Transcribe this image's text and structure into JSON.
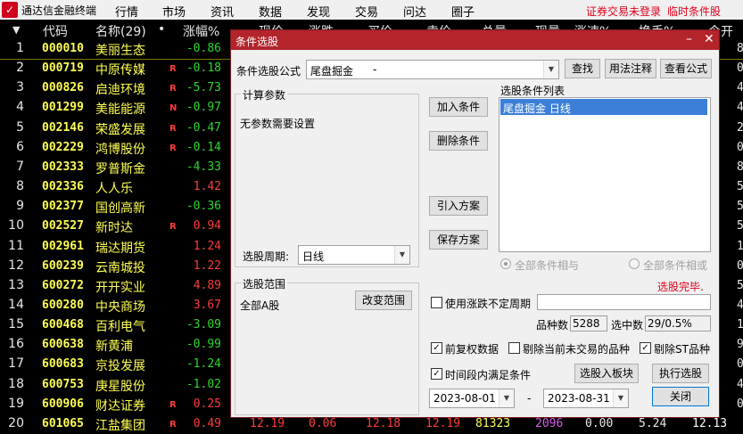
{
  "menubar": {
    "app_title": "通达信金融终端",
    "items": [
      "行情",
      "市场",
      "资讯",
      "数据",
      "发现",
      "交易",
      "问达",
      "圈子"
    ],
    "trade_status": "证券交易未登录",
    "temp_filter": "临时条件股"
  },
  "table": {
    "headers": {
      "idx": "▼",
      "code": "代码",
      "name": "名称(29)",
      "dot": "•",
      "pct": "涨幅%",
      "cur": "现价",
      "chg": "涨跌",
      "bid": "买价",
      "ask": "卖价",
      "vol": "总量",
      "now_vol": "现量",
      "speed": "涨速%",
      "turn": "换手%",
      "open": "今开"
    },
    "rows": [
      {
        "idx": "1",
        "code": "000010",
        "name": "美丽生态",
        "flag": "",
        "pct": "-0.86",
        "tail": "8"
      },
      {
        "idx": "2",
        "code": "000719",
        "name": "中原传媒",
        "flag": "R",
        "pct": "-0.18",
        "tail": "0"
      },
      {
        "idx": "3",
        "code": "000826",
        "name": "启迪环境",
        "flag": "R",
        "pct": "-5.73",
        "tail": "4"
      },
      {
        "idx": "4",
        "code": "001299",
        "name": "美能能源",
        "flag": "N",
        "pct": "-0.97",
        "tail": "4"
      },
      {
        "idx": "5",
        "code": "002146",
        "name": "荣盛发展",
        "flag": "R",
        "pct": "-0.47",
        "tail": "2"
      },
      {
        "idx": "6",
        "code": "002229",
        "name": "鸿博股份",
        "flag": "R",
        "pct": "-0.14",
        "tail": "0"
      },
      {
        "idx": "7",
        "code": "002333",
        "name": "罗普斯金",
        "flag": "",
        "pct": "-4.33",
        "tail": "8"
      },
      {
        "idx": "8",
        "code": "002336",
        "name": "人人乐",
        "flag": "",
        "pct": "1.42",
        "tail": "5"
      },
      {
        "idx": "9",
        "code": "002377",
        "name": "国创高新",
        "flag": "",
        "pct": "-0.36",
        "tail": "5"
      },
      {
        "idx": "10",
        "code": "002527",
        "name": "新时达",
        "flag": "R",
        "pct": "0.94",
        "tail": "5"
      },
      {
        "idx": "11",
        "code": "002961",
        "name": "瑞达期货",
        "flag": "",
        "pct": "1.24",
        "tail": "1"
      },
      {
        "idx": "12",
        "code": "600239",
        "name": "云南城投",
        "flag": "",
        "pct": "1.22",
        "tail": "0"
      },
      {
        "idx": "13",
        "code": "600272",
        "name": "开开实业",
        "flag": "",
        "pct": "4.89",
        "tail": "5"
      },
      {
        "idx": "14",
        "code": "600280",
        "name": "中央商场",
        "flag": "",
        "pct": "3.67",
        "tail": "4"
      },
      {
        "idx": "15",
        "code": "600468",
        "name": "百利电气",
        "flag": "",
        "pct": "-3.09",
        "tail": "1"
      },
      {
        "idx": "16",
        "code": "600638",
        "name": "新黄浦",
        "flag": "",
        "pct": "-0.99",
        "tail": "9"
      },
      {
        "idx": "17",
        "code": "600683",
        "name": "京投发展",
        "flag": "",
        "pct": "-1.24",
        "tail": "0"
      },
      {
        "idx": "18",
        "code": "600753",
        "name": "庚星股份",
        "flag": "",
        "pct": "-1.02",
        "tail": "4"
      },
      {
        "idx": "19",
        "code": "600906",
        "name": "财达证券",
        "flag": "R",
        "pct": "0.25",
        "tail": "0"
      },
      {
        "idx": "20",
        "code": "601065",
        "name": "江盐集团",
        "flag": "R",
        "pct": "0.49",
        "cur": "12.19",
        "chg": "0.06",
        "bid": "12.18",
        "ask": "12.19",
        "vol": "81323",
        "now_vol": "2096",
        "speed": "0.00",
        "turn": "5.24",
        "open": "12.13"
      }
    ]
  },
  "dialog": {
    "title": "条件选股",
    "formula_label": "条件选股公式",
    "formula_value": "尾盘掘金",
    "formula_dash": "-",
    "btn_find": "查找",
    "btn_usage": "用法注释",
    "btn_view": "查看公式",
    "params_group": "计算参数",
    "params_text": "无参数需要设置",
    "period_label": "选股周期:",
    "period_value": "日线",
    "btn_add": "加入条件",
    "btn_delete": "删除条件",
    "btn_import": "引入方案",
    "btn_save": "保存方案",
    "list_label": "选股条件列表",
    "list_items": [
      "尾盘掘金  日线"
    ],
    "radio_and": "全部条件相与",
    "radio_or": "全部条件相或",
    "status": "选股完毕.",
    "range_group": "选股范围",
    "range_value": "全部A股",
    "btn_range": "改变范围",
    "use_period_label": "使用涨跌不定周期",
    "count_label": "品种数",
    "count_value": "5288",
    "selected_label": "选中数",
    "selected_value": "29/0.5%",
    "chk_restore": "前复权数据",
    "chk_remove_untraded": "剔除当前未交易的品种",
    "chk_remove_st": "剔除ST品种",
    "chk_time": "时间段内满足条件",
    "btn_to_block": "选股入板块",
    "btn_execute": "执行选股",
    "date_from": "2023-08-01",
    "date_sep": "-",
    "date_to": "2023-08-31",
    "btn_close": "关闭"
  }
}
